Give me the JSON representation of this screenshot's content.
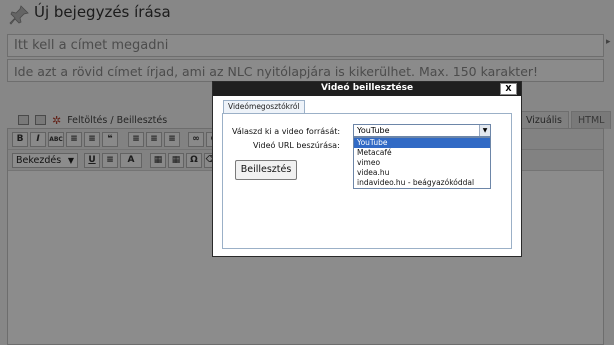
{
  "page": {
    "title": "Új bejegyzés írása",
    "title_placeholder": "Itt kell a címet megadni",
    "excerpt_placeholder": "Ide azt a rövid címet írjad, ami az NLC nyitólapjára is kikerülhet. Max. 150 karakter!",
    "icons": [
      "pushpin-icon",
      "image-icon",
      "media-icon",
      "gear-icon",
      "expand-arrow-icon"
    ]
  },
  "media_bar": {
    "upload_label": "Feltöltés / Beillesztés"
  },
  "editor_tabs": {
    "visual": "Vizuális",
    "html": "HTML"
  },
  "toolbar": {
    "row1": [
      "B",
      "I",
      "ABC",
      "≡",
      "≡",
      "❝",
      "≡",
      "≡",
      "≡",
      "∞",
      "⊘",
      "▭",
      "▣"
    ],
    "format_value": "Bekezdés",
    "row2": [
      "U",
      "≡",
      "A",
      "▦",
      "▦",
      "Ω",
      "⌫"
    ]
  },
  "dialog": {
    "title": "Videó beillesztése",
    "close_label": "X",
    "tab_label": "Videómegosztókról",
    "source_label": "Válaszd ki a video forrását:",
    "url_label": "Videó URL beszúrása:",
    "selected_source": "YouTube",
    "options": [
      "YouTube",
      "Metacafé",
      "vimeo",
      "videa.hu",
      "indavideo.hu - beágyazókóddal"
    ],
    "insert_button": "Beillesztés"
  },
  "colors": {
    "dialog_titlebar": "#1f1f1f",
    "selection": "#316ac5",
    "overlay": "rgba(0,0,0,0.45)"
  }
}
